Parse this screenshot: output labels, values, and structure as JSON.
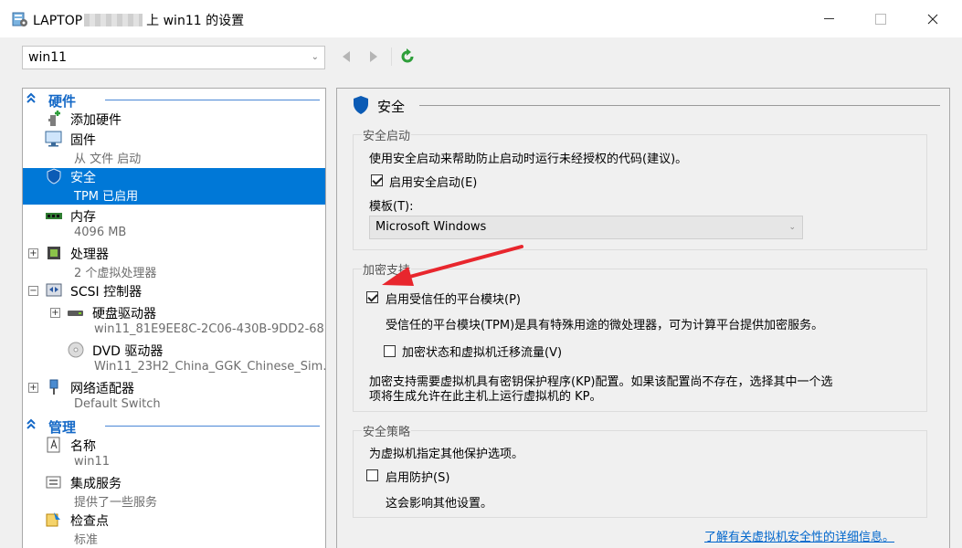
{
  "window": {
    "title_prefix": "LAPTOP",
    "title_suffix": "上 win11 的设置"
  },
  "toolbar": {
    "vm_selected": "win11"
  },
  "tree": {
    "hardware_header": "硬件",
    "management_header": "管理",
    "items": [
      {
        "label": "添加硬件",
        "sub": ""
      },
      {
        "label": "固件",
        "sub": "从 文件 启动"
      },
      {
        "label": "安全",
        "sub": "TPM 已启用"
      },
      {
        "label": "内存",
        "sub": "4096 MB"
      },
      {
        "label": "处理器",
        "sub": "2 个虚拟处理器"
      },
      {
        "label": "SCSI 控制器",
        "sub": ""
      },
      {
        "label": "硬盘驱动器",
        "sub": "win11_81E9EE8C-2C06-430B-9DD2-68..."
      },
      {
        "label": "DVD 驱动器",
        "sub": "Win11_23H2_China_GGK_Chinese_Sim..."
      },
      {
        "label": "网络适配器",
        "sub": "Default Switch"
      },
      {
        "label": "名称",
        "sub": "win11"
      },
      {
        "label": "集成服务",
        "sub": "提供了一些服务"
      },
      {
        "label": "检查点",
        "sub": "标准"
      }
    ]
  },
  "security": {
    "header": "安全",
    "secure_boot": {
      "group_title": "安全启动",
      "description": "使用安全启动来帮助防止启动时运行未经授权的代码(建议)。",
      "enable_label": "启用安全启动(E)",
      "enable_checked": true,
      "template_label": "模板(T):",
      "template_value": "Microsoft Windows"
    },
    "encryption": {
      "group_title": "加密支持",
      "tpm_label": "启用受信任的平台模块(P)",
      "tpm_checked": true,
      "tpm_description": "受信任的平台模块(TPM)是具有特殊用途的微处理器，可为计算平台提供加密服务。",
      "encrypt_state_label": "加密状态和虚拟机迁移流量(V)",
      "encrypt_state_checked": false,
      "kp_note_line1": "加密支持需要虚拟机具有密钥保护程序(KP)配置。如果该配置尚不存在，选择其中一个选",
      "kp_note_line2": "项将生成允许在此主机上运行虚拟机的 KP。"
    },
    "policy": {
      "group_title": "安全策略",
      "description": "为虚拟机指定其他保护选项。",
      "shield_label": "启用防护(S)",
      "shield_checked": false,
      "shield_note": "这会影响其他设置。"
    },
    "learn_more": "了解有关虚拟机安全性的详细信息。"
  },
  "colors": {
    "accent": "#0078d7",
    "header_blue": "#1569c7",
    "arrow_red": "#e8262d",
    "refresh_green": "#2e9e3a"
  }
}
